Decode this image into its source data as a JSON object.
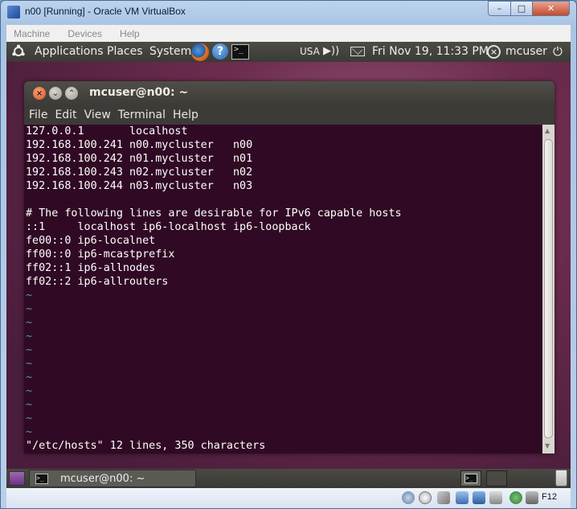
{
  "vbox": {
    "title": "n00 [Running] - Oracle VM VirtualBox",
    "menu": [
      "Machine",
      "Devices",
      "Help"
    ],
    "host_key": "F12"
  },
  "top_panel": {
    "applications": "Applications",
    "places": "Places",
    "system": "System",
    "keyboard_layout": "USA",
    "clock": "Fri Nov 19, 11:33 PM",
    "user": "mcuser"
  },
  "terminal": {
    "title": "mcuser@n00: ~",
    "menu": [
      "File",
      "Edit",
      "View",
      "Terminal",
      "Help"
    ],
    "lines": [
      "127.0.0.1       localhost",
      "192.168.100.241 n00.mycluster   n00",
      "192.168.100.242 n01.mycluster   n01",
      "192.168.100.243 n02.mycluster   n02",
      "192.168.100.244 n03.mycluster   n03",
      "",
      "# The following lines are desirable for IPv6 capable hosts",
      "::1     localhost ip6-localhost ip6-loopback",
      "fe00::0 ip6-localnet",
      "ff00::0 ip6-mcastprefix",
      "ff02::1 ip6-allnodes",
      "ff02::2 ip6-allrouters"
    ],
    "tildes": [
      "~",
      "~",
      "~",
      "~",
      "~",
      "~",
      "~",
      "~",
      "~",
      "~",
      "~"
    ],
    "status": "\"/etc/hosts\" 12 lines, 350 characters"
  },
  "bottom_panel": {
    "taskbar_label": "mcuser@n00: ~"
  }
}
